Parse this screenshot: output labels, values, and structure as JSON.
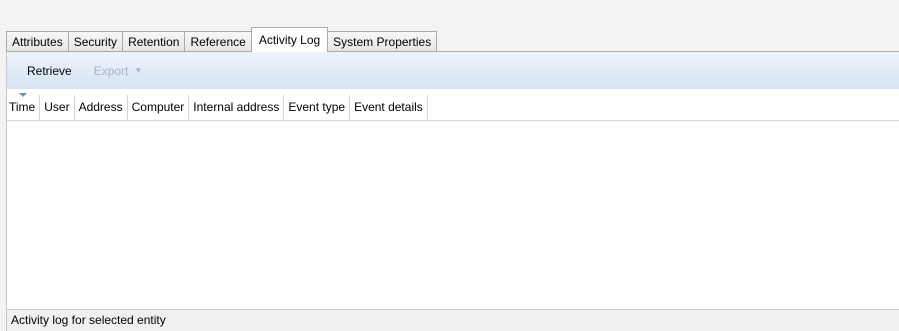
{
  "tabs": [
    {
      "label": "Attributes",
      "active": false
    },
    {
      "label": "Security",
      "active": false
    },
    {
      "label": "Retention",
      "active": false
    },
    {
      "label": "Reference",
      "active": false
    },
    {
      "label": "Activity Log",
      "active": true
    },
    {
      "label": "System Properties",
      "active": false
    }
  ],
  "toolbar": {
    "retrieve_label": "Retrieve",
    "export_label": "Export",
    "export_arrow": "▼"
  },
  "grid": {
    "columns": [
      "Time",
      "User",
      "Address",
      "Computer",
      "Internal address",
      "Event type",
      "Event details"
    ],
    "rows": []
  },
  "status": {
    "text": "Activity log for selected entity"
  },
  "colors": {
    "toolbar_gradient_top": "#eef4fb",
    "toolbar_gradient_bottom": "#d6e3f3",
    "sort_indicator": "#6a8fbf",
    "disabled_text": "#a8b4c4"
  }
}
